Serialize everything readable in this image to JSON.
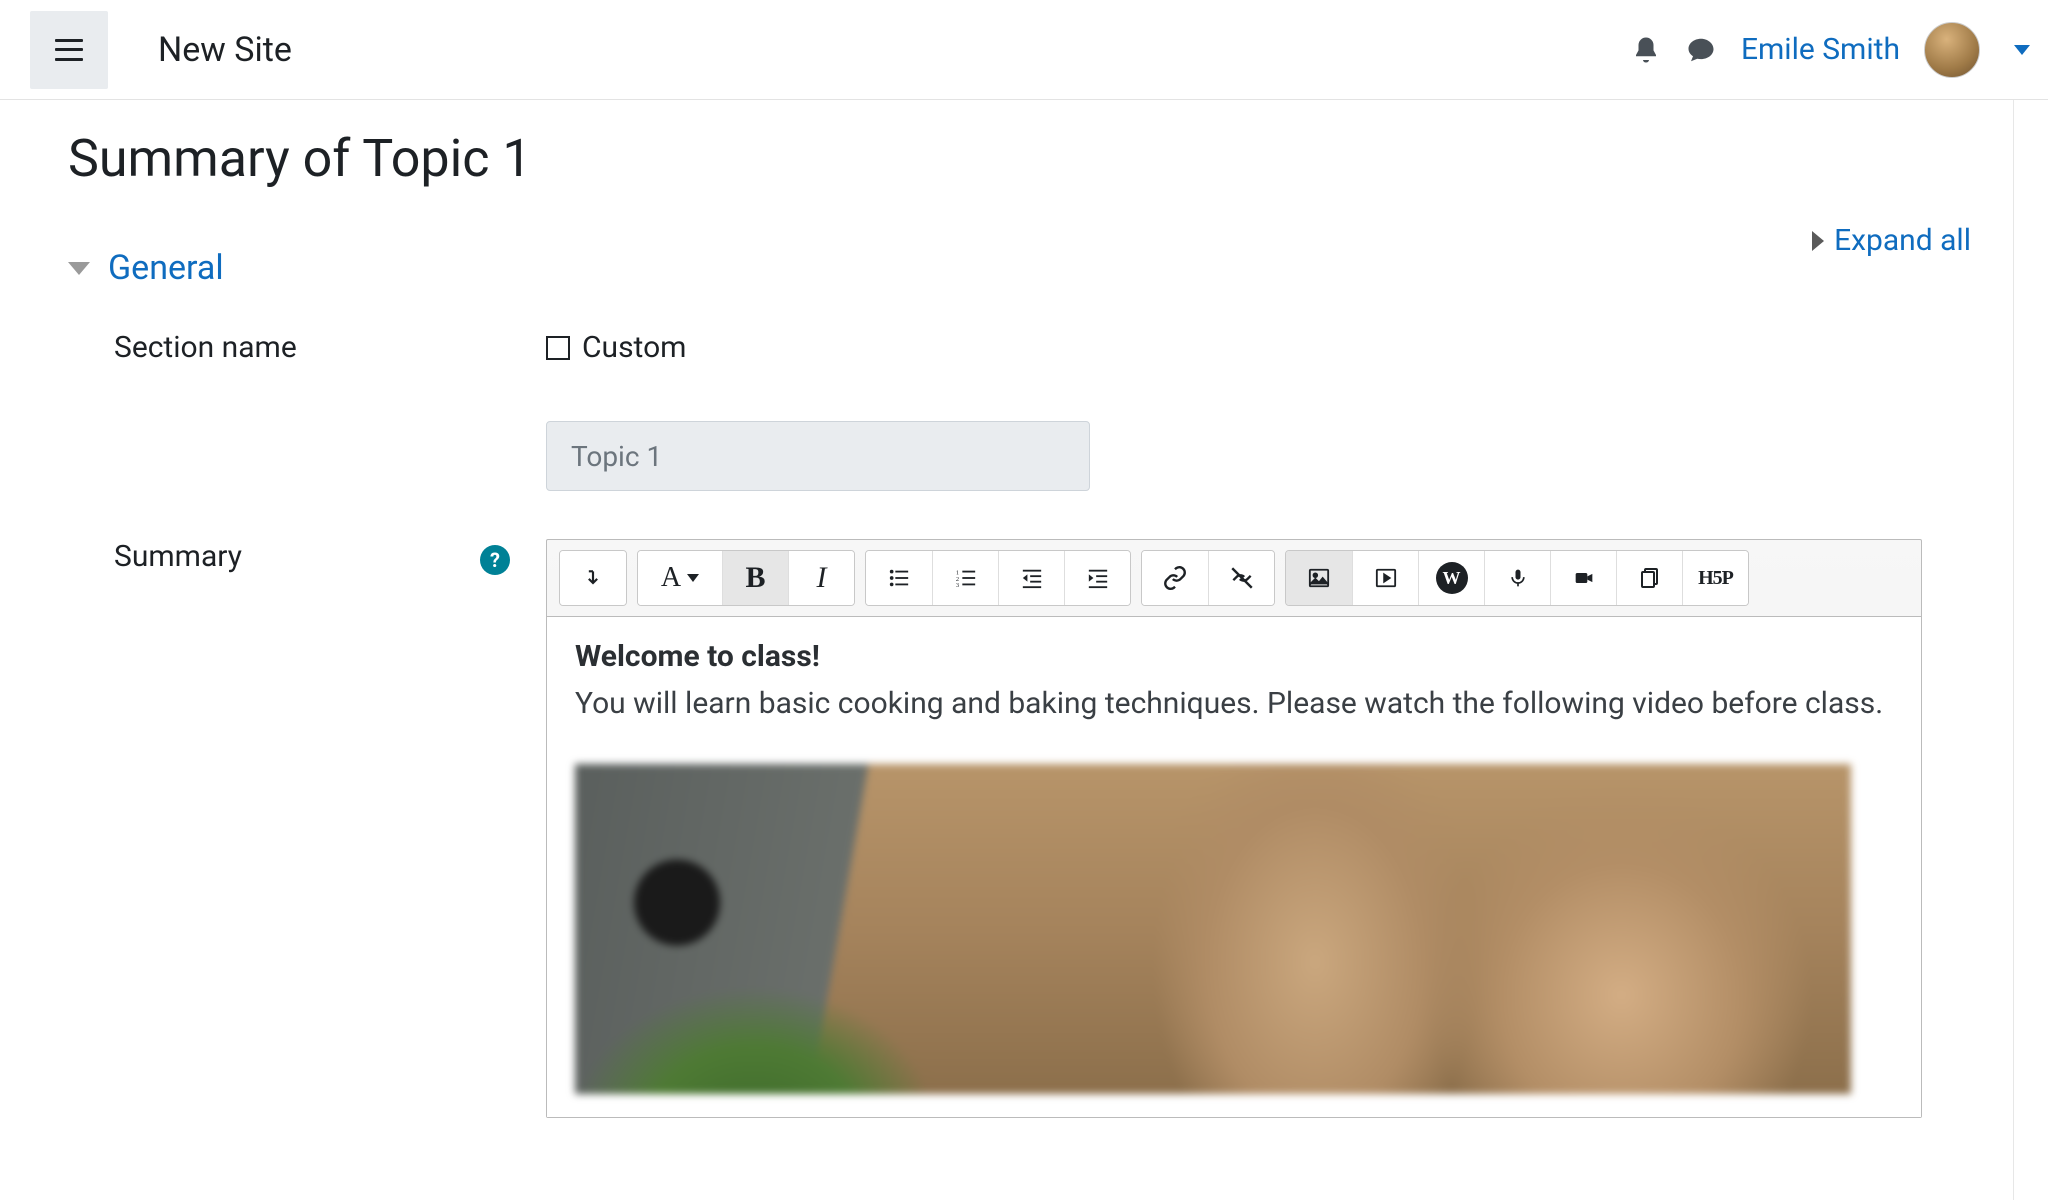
{
  "topbar": {
    "site_name": "New Site",
    "user_name": "Emile Smith"
  },
  "page": {
    "title": "Summary of Topic 1",
    "expand_all": "Expand all"
  },
  "section": {
    "general": "General",
    "section_name_label": "Section name",
    "custom_label": "Custom",
    "section_name_value": "Topic 1",
    "summary_label": "Summary"
  },
  "editor": {
    "content_heading": "Welcome to class!",
    "content_body": "You will learn basic cooking and baking techniques. Please watch the following video before class.",
    "h5p_label": "H5P"
  }
}
